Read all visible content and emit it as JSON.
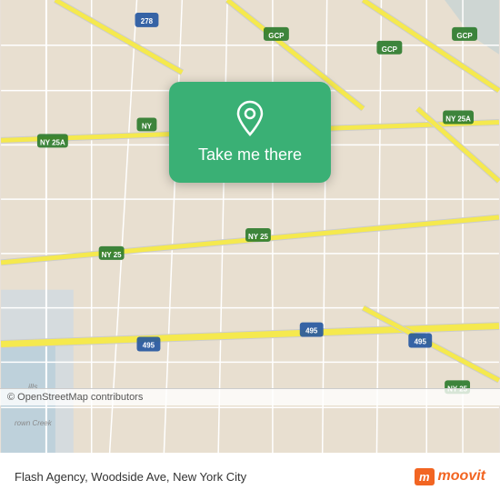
{
  "map": {
    "background_color": "#e8dfd0",
    "road_color_major": "#f5e94e",
    "road_color_minor": "#ffffff",
    "road_color_outline": "#cccccc"
  },
  "card": {
    "button_label": "Take me there",
    "background_color": "#3ab075",
    "pin_icon": "location-pin"
  },
  "copyright": {
    "text": "© OpenStreetMap contributors"
  },
  "address": {
    "text": "Flash Agency, Woodside Ave, New York City"
  },
  "branding": {
    "logo_letter": "m",
    "logo_text": "moovit"
  }
}
